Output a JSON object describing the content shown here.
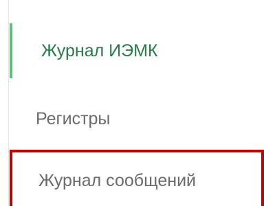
{
  "nav": {
    "items": [
      {
        "label": "Журнал ИЭМК",
        "state": "active"
      },
      {
        "label": "Регистры",
        "state": "default"
      },
      {
        "label": "Журнал сообщений",
        "state": "highlighted"
      }
    ]
  },
  "colors": {
    "active_text": "#2a7a4b",
    "active_indicator": "#5cc17a",
    "inactive_text": "#6b6b6b",
    "highlight_border": "#c00000",
    "divider": "#e6e6e6"
  }
}
